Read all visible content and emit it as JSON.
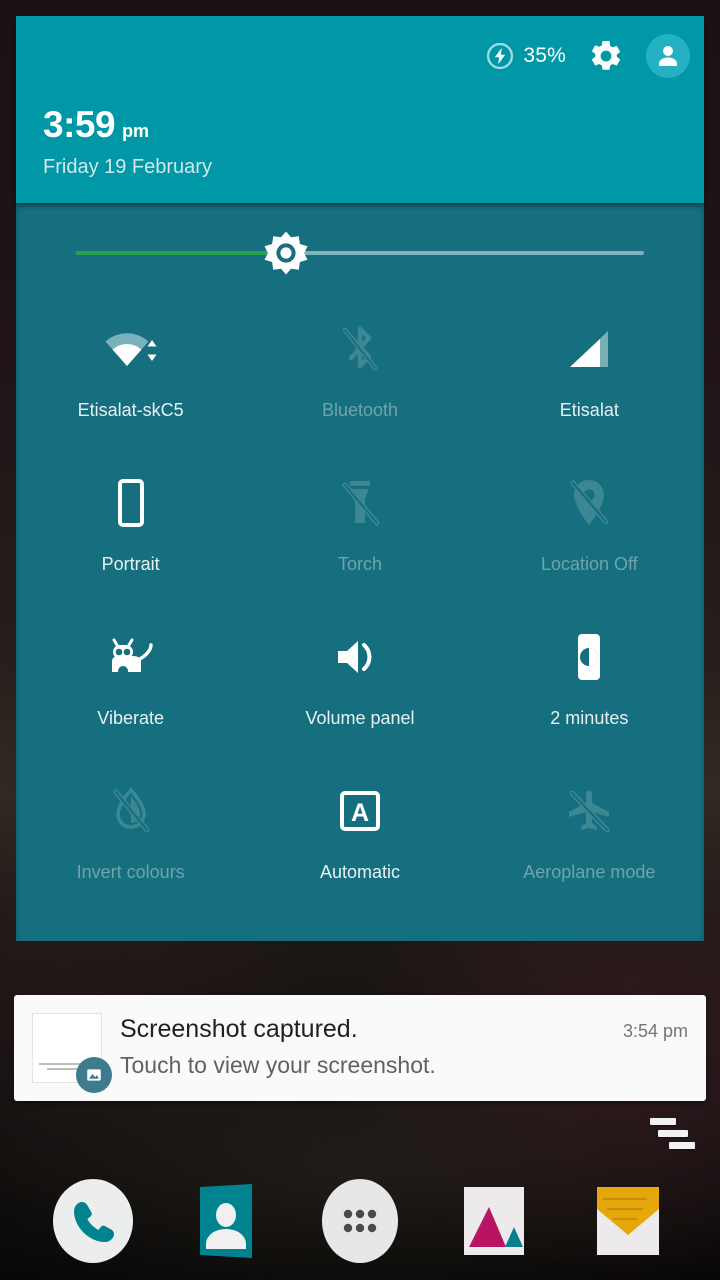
{
  "header": {
    "battery_icon": "battery-charging-icon",
    "battery_percent": "35%",
    "settings_icon": "gear-icon",
    "avatar_icon": "user-avatar-icon",
    "time": "3:59",
    "ampm": "pm",
    "date": "Friday 19 February"
  },
  "brightness": {
    "icon": "brightness-sun-icon",
    "level_percent": 37,
    "fill_color": "#27a04f",
    "track_color": "#7fb3bb"
  },
  "quick_settings": {
    "tiles": [
      {
        "id": "wifi",
        "label": "Etisalat-skC5",
        "icon": "wifi-icon",
        "state": "on"
      },
      {
        "id": "bluetooth",
        "label": "Bluetooth",
        "icon": "bluetooth-off-icon",
        "state": "off"
      },
      {
        "id": "cell-signal",
        "label": "Etisalat",
        "icon": "signal-bars-icon",
        "state": "on"
      },
      {
        "id": "rotation",
        "label": "Portrait",
        "icon": "screen-portrait-icon",
        "state": "on"
      },
      {
        "id": "torch",
        "label": "Torch",
        "icon": "torch-off-icon",
        "state": "off"
      },
      {
        "id": "location",
        "label": "Location Off",
        "icon": "location-off-icon",
        "state": "off"
      },
      {
        "id": "ringer-mode",
        "label": "Viberate",
        "icon": "cyanogenmod-cid-icon",
        "state": "on"
      },
      {
        "id": "volume-panel",
        "label": "Volume panel",
        "icon": "speaker-icon",
        "state": "on"
      },
      {
        "id": "screen-timeout",
        "label": "2 minutes",
        "icon": "screen-timeout-icon",
        "state": "on"
      },
      {
        "id": "invert-colours",
        "label": "Invert colours",
        "icon": "invert-colours-off-icon",
        "state": "off"
      },
      {
        "id": "brightness-mode",
        "label": "Automatic",
        "icon": "auto-brightness-icon",
        "state": "on"
      },
      {
        "id": "aeroplane-mode",
        "label": "Aeroplane mode",
        "icon": "aeroplane-off-icon",
        "state": "off"
      }
    ]
  },
  "notification": {
    "title": "Screenshot captured.",
    "subtitle": "Touch to view your screenshot.",
    "time": "3:54 pm",
    "thumb_icon": "image-badge-icon"
  },
  "dismiss_all": {
    "icon": "clear-all-notifications-icon"
  },
  "dock": {
    "items": [
      {
        "id": "phone",
        "icon": "phone-icon"
      },
      {
        "id": "contacts",
        "icon": "contacts-icon"
      },
      {
        "id": "app-drawer",
        "icon": "app-drawer-icon"
      },
      {
        "id": "gallery",
        "icon": "gallery-icon"
      },
      {
        "id": "email",
        "icon": "email-icon"
      }
    ]
  },
  "colors": {
    "header_bg": "#0097a7",
    "panel_bg": "#156f7e",
    "accent_green": "#27a04f",
    "tile_on_text": "#e7f2f4",
    "tile_off_text": "#6fa3ad"
  }
}
